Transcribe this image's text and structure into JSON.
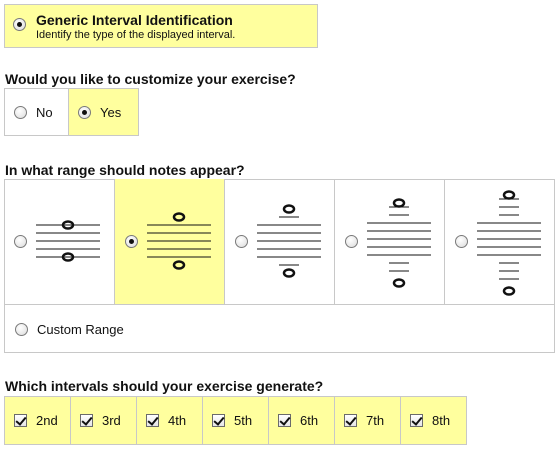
{
  "exercise": {
    "title": "Generic Interval Identification",
    "subtitle": "Identify the type of the displayed interval.",
    "selected": true
  },
  "customize": {
    "question": "Would you like to customize your exercise?",
    "options": [
      {
        "label": "No",
        "selected": false
      },
      {
        "label": "Yes",
        "selected": true
      }
    ]
  },
  "range": {
    "question": "In what range should notes appear?",
    "options": [
      {
        "id": "range-1",
        "selected": false
      },
      {
        "id": "range-2",
        "selected": true
      },
      {
        "id": "range-3",
        "selected": false
      },
      {
        "id": "range-4",
        "selected": false
      },
      {
        "id": "range-5",
        "selected": false
      }
    ],
    "custom_label": "Custom Range",
    "custom_selected": false
  },
  "intervals": {
    "question": "Which intervals should your exercise generate?",
    "items": [
      {
        "label": "2nd",
        "checked": true
      },
      {
        "label": "3rd",
        "checked": true
      },
      {
        "label": "4th",
        "checked": true
      },
      {
        "label": "5th",
        "checked": true
      },
      {
        "label": "6th",
        "checked": true
      },
      {
        "label": "7th",
        "checked": true
      },
      {
        "label": "8th",
        "checked": true
      }
    ]
  },
  "colors": {
    "highlight": "#ffff9e",
    "border": "#c8c8c8"
  }
}
